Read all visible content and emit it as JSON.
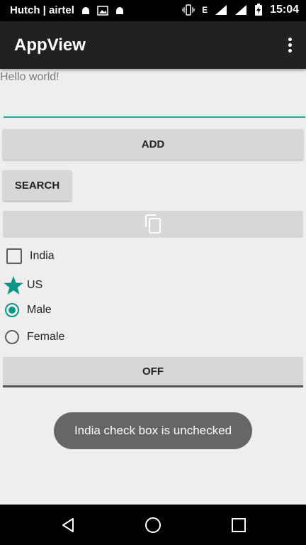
{
  "status_bar": {
    "carrier": "Hutch | airtel",
    "network_type": "E",
    "time": "15:04"
  },
  "app_bar": {
    "title": "AppView"
  },
  "content": {
    "hello_text": "Hello world!",
    "input_value": "",
    "add_button": "ADD",
    "search_button": "SEARCH",
    "copy_button_icon": "copy-icon",
    "checkbox_india": {
      "label": "India",
      "checked": false
    },
    "star_us": {
      "label": "US",
      "checked": true
    },
    "radio_male": {
      "label": "Male",
      "checked": true
    },
    "radio_female": {
      "label": "Female",
      "checked": false
    },
    "toggle_label": "OFF",
    "toast_text": "India check box is unchecked"
  },
  "colors": {
    "accent": "#0f9488",
    "toolbar": "#212121",
    "background": "#eeeeee"
  }
}
